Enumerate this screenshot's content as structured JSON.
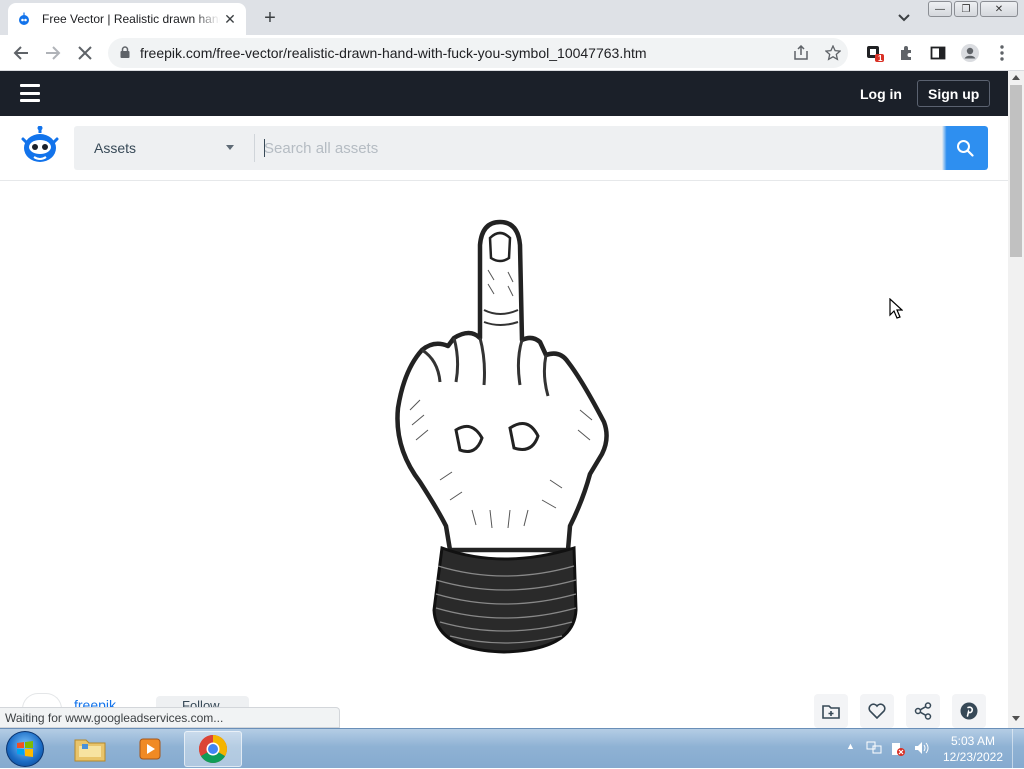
{
  "browser": {
    "tab": {
      "title": "Free Vector | Realistic drawn hand wit",
      "favicon": "freepik-logo-icon",
      "close": "✕"
    },
    "new_tab": "+",
    "tab_search": "⌄",
    "window_controls": {
      "minimize": "—",
      "restore": "❐",
      "close": "✕"
    },
    "url": "freepik.com/free-vector/realistic-drawn-hand-with-fuck-you-symbol_10047763.htm",
    "extension_badge": "1",
    "status": "Waiting for www.googleadservices.com..."
  },
  "site": {
    "header": {
      "login": "Log in",
      "signup": "Sign up"
    },
    "search": {
      "category": "Assets",
      "placeholder": "Search all assets",
      "value": ""
    },
    "author": {
      "name": "freepik",
      "follow": "Follow"
    },
    "accent": "#1273eb",
    "header_bg": "#1b2029"
  },
  "taskbar": {
    "time": "5:03 AM",
    "date": "12/23/2022",
    "apps": [
      "windows-explorer",
      "media-player",
      "chrome"
    ]
  }
}
